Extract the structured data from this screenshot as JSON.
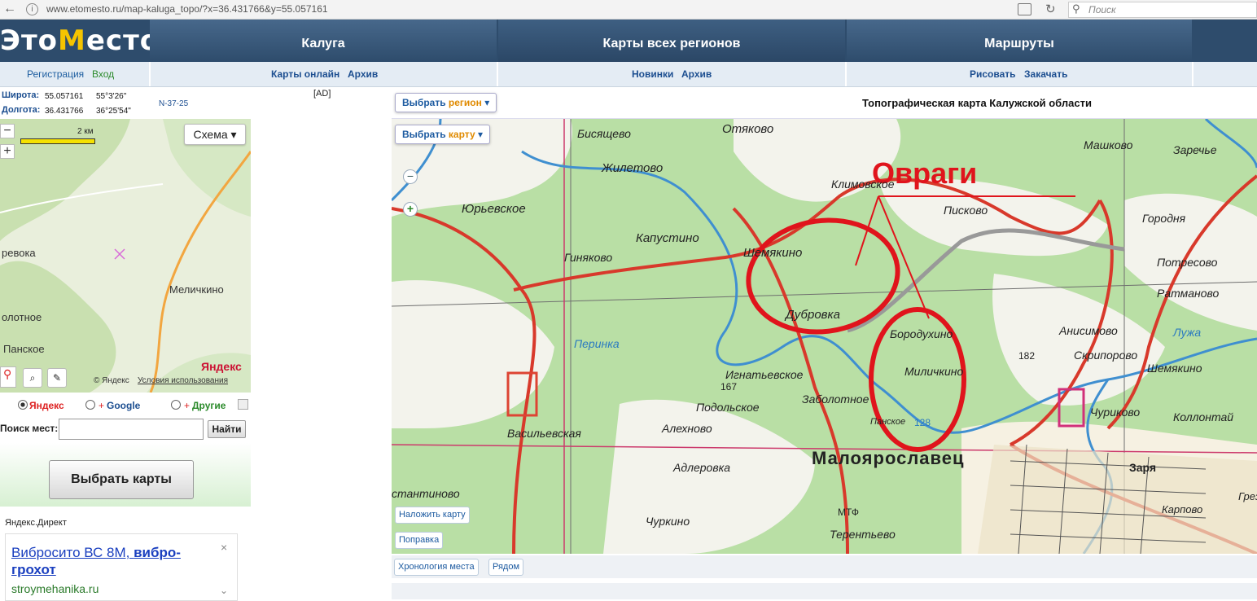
{
  "browser": {
    "url": "www.etomesto.ru/map-kaluga_topo/?x=36.431766&y=55.057161",
    "search_placeholder": "Поиск",
    "back_glyph": "←",
    "info_glyph": "i",
    "reload_glyph": "↻",
    "search_glyph": "⚲"
  },
  "logo": {
    "pre": "Это",
    "accent": "М",
    "post": "есто"
  },
  "nav": {
    "tabs": [
      "Калуга",
      "Карты всех регионов",
      "Маршруты"
    ],
    "sub": {
      "register": "Регистрация",
      "login": "Вход",
      "maps_online": "Карты онлайн",
      "archive1": "Архив",
      "new": "Новинки",
      "archive2": "Архив",
      "draw": "Рисовать",
      "download": "Закачать"
    }
  },
  "coords": {
    "lat_label": "Широта:",
    "lat_dec": "55.057161",
    "lat_dms": "55°3'26\"",
    "lon_label": "Долгота:",
    "lon_dec": "36.431766",
    "lon_dms": "36°25'54\"",
    "sheet": "N-37-25"
  },
  "mini_map": {
    "scheme_label": "Схема ▾",
    "scale_label": "2 км",
    "zoom_out": "−",
    "zoom_in": "+",
    "places": [
      "ревока",
      "Меличкино",
      "олотное",
      "Панское"
    ],
    "brand": "Яндекс",
    "copyright": "© Яндекс",
    "terms": "Условия использования"
  },
  "providers": {
    "yandex": "Яндекс",
    "google": "Google",
    "other": "Другие",
    "plus": "+"
  },
  "search": {
    "label": "Поиск мест:",
    "button": "Найти",
    "value": ""
  },
  "choose_maps": "Выбрать карты",
  "ad_label": "[AD]",
  "direct": {
    "label": "Яндекс.Директ",
    "title_normal": "Вибросито ВС 8М, ",
    "title_bold": "вибро-грохот",
    "url": "stroymehanika.ru",
    "close": "×",
    "chevron": "⌄"
  },
  "main_map": {
    "title": "Топографическая карта Калужской области",
    "select_region_pre": "Выбрать ",
    "select_region_accent": "регион",
    "select_map_pre": "Выбрать ",
    "select_map_accent": "карту",
    "overlay": "Наложить карту",
    "correction": "Поправка",
    "zoom_out": "−",
    "zoom_in": "+",
    "annotation": "Овраги",
    "places": [
      "Отяково",
      "Бисящево",
      "Жилетово",
      "Климовское",
      "Машково",
      "Заречье",
      "Юрьевское",
      "Капустино",
      "Шемякино",
      "Писково",
      "Городня",
      "Гиняково",
      "Потресово",
      "Дубровка",
      "Ратманово",
      "Бородухино",
      "Анисимово",
      "Лужа",
      "Перинка",
      "Миличкино",
      "Скрипорово",
      "Игнатьевское",
      "Шемякино",
      "Подольское",
      "Заболотное",
      "Васильевская",
      "Алехново",
      "Панское",
      "Чуриково",
      "Коллонтай",
      "Малоярославец",
      "Адлеровка",
      "Заря",
      "стантиново",
      "Карпово",
      "Чуркино",
      "МТФ",
      "Терентьево",
      "Грез"
    ],
    "numbers": [
      "167",
      "182",
      "128"
    ]
  },
  "bottom": {
    "chronology": "Хронология места",
    "nearby": "Рядом"
  },
  "colors": {
    "header": "#2e4c6c",
    "link": "#1c4e90",
    "road_red": "#d8392b",
    "annotation_red": "#e0141c",
    "river_blue": "#3f8fd0",
    "forest": "#b9dfa5",
    "field": "#f3f3ec"
  }
}
